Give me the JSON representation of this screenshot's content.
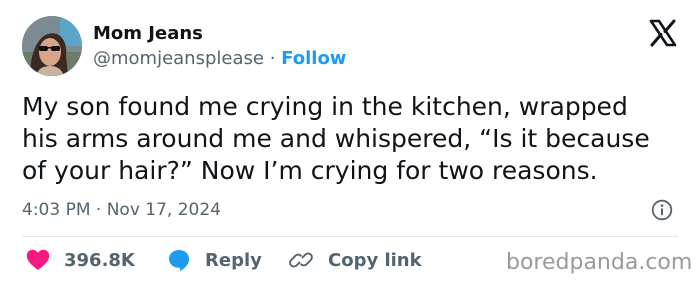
{
  "author": {
    "name": "Mom Jeans",
    "handle": "@momjeansplease",
    "separator": "·",
    "follow_label": "Follow"
  },
  "tweet": {
    "lines": [
      "My son found me crying in the kitchen, wrapped",
      "his arms around me and whispered, “Is it because",
      "of your hair?” Now I’m crying for two reasons."
    ],
    "timestamp": "4:03 PM · Nov 17, 2024"
  },
  "actions": {
    "likes_count": "396.8K",
    "reply_label": "Reply",
    "copy_label": "Copy link"
  },
  "watermark": "boredpanda.com",
  "icons": {
    "like": "heart-icon",
    "reply": "speech-bubble-icon",
    "copy": "link-icon",
    "info": "info-icon",
    "brand": "x-logo-icon"
  },
  "colors": {
    "accent": "#1d9bf0",
    "like": "#f91880",
    "text": "#0f1419",
    "muted": "#536471"
  }
}
